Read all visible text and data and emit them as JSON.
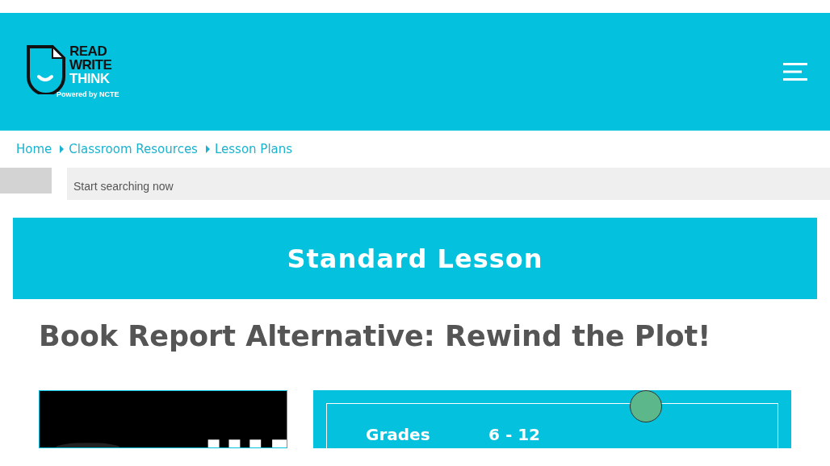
{
  "logo": {
    "lines": [
      "READ",
      "WRITE",
      "THINK"
    ],
    "tagline": "Powered by NCTE"
  },
  "breadcrumb": [
    "Home",
    "Classroom Resources",
    "Lesson Plans"
  ],
  "search": {
    "placeholder": "Start searching now"
  },
  "banner": "Standard Lesson",
  "title": "Book Report Alternative: Rewind the Plot!",
  "details": [
    {
      "label": "Grades",
      "value": "6 - 12"
    }
  ]
}
